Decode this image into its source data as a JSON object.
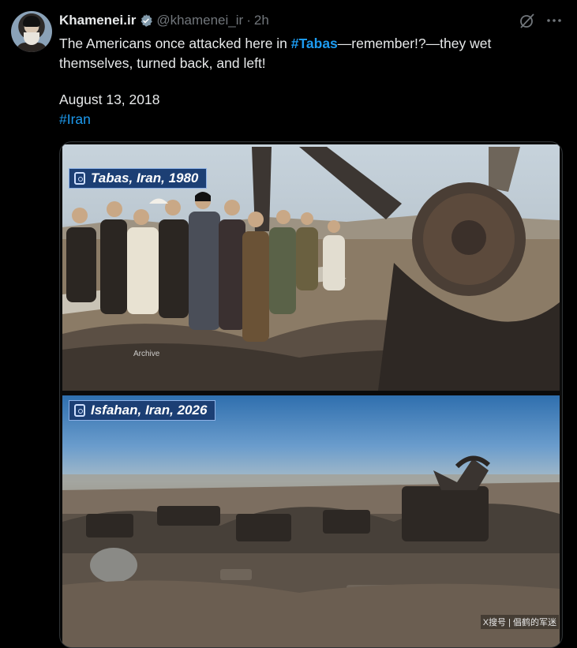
{
  "post": {
    "display_name": "Khamenei.ir",
    "handle": "@khamenei_ir",
    "separator": "·",
    "time": "2h",
    "text_before_tag": "The Americans once attacked here in ",
    "tag": "#Tabas",
    "text_after_tag": "—remember!?—they wet themselves, turned back, and left!",
    "date_line": "August 13, 2018",
    "hashtag_line": "#Iran"
  },
  "icons": {
    "verified": "verified-badge-icon",
    "grok": "grok-icon",
    "more": "more-options-icon",
    "label": "camera-icon"
  },
  "media": {
    "photo1_label": "Tabas, Iran, 1980",
    "photo1_credit": "Archive",
    "photo2_label": "Isfahan, Iran, 2026",
    "watermark": "X搜号 | 倡鹤的军迷"
  },
  "colors": {
    "background": "#000000",
    "text": "#e7e9ea",
    "muted": "#71767b",
    "link": "#1d9bf0",
    "label_bg": "#1c3f74"
  }
}
